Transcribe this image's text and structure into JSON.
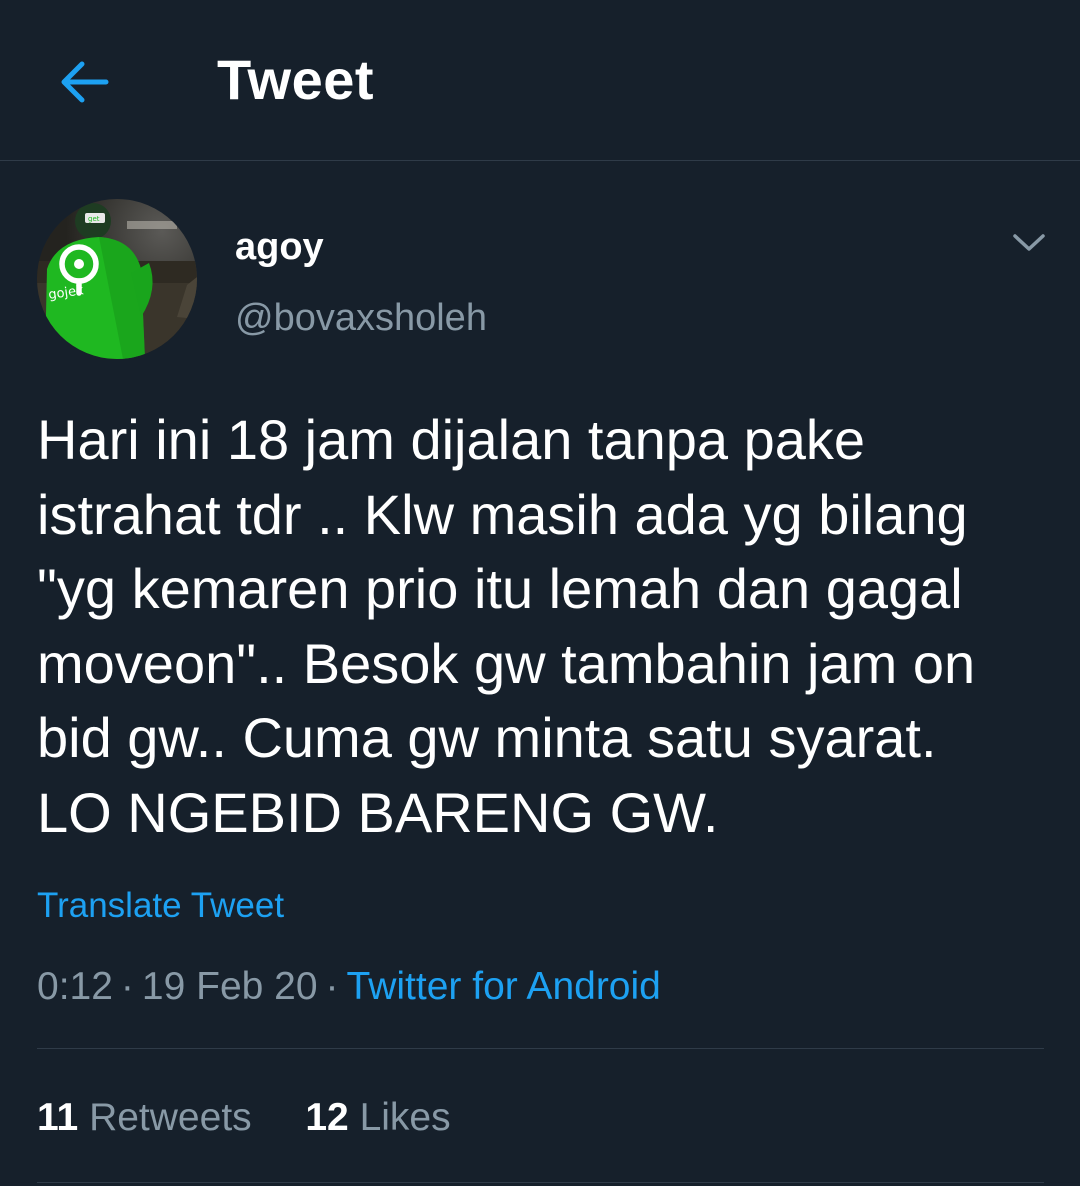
{
  "header": {
    "title": "Tweet",
    "back_icon": "arrow-left-icon"
  },
  "tweet": {
    "display_name": "agoy",
    "handle": "@bovaxsholeh",
    "avatar_text": "gojek",
    "avatar_badge_text": "get",
    "text": "Hari ini 18 jam dijalan tanpa pake\nistrahat tdr .. Klw masih ada yg bilang\n\"yg kemaren prio itu lemah dan gagal\nmoveon\".. Besok gw tambahin jam on\nbid gw.. Cuma gw minta satu syarat.\nLO NGEBID BARENG GW.",
    "translate_label": "Translate Tweet",
    "time": "0:12",
    "date": "19 Feb 20",
    "separator": "·",
    "source": "Twitter for Android",
    "retweets_count": "11",
    "retweets_label": "Retweets",
    "likes_count": "12",
    "likes_label": "Likes"
  },
  "colors": {
    "background": "#16202b",
    "accent": "#1da1f2",
    "muted": "#8899a6",
    "divider": "#2f3b48",
    "gojek_green": "#21c224"
  }
}
